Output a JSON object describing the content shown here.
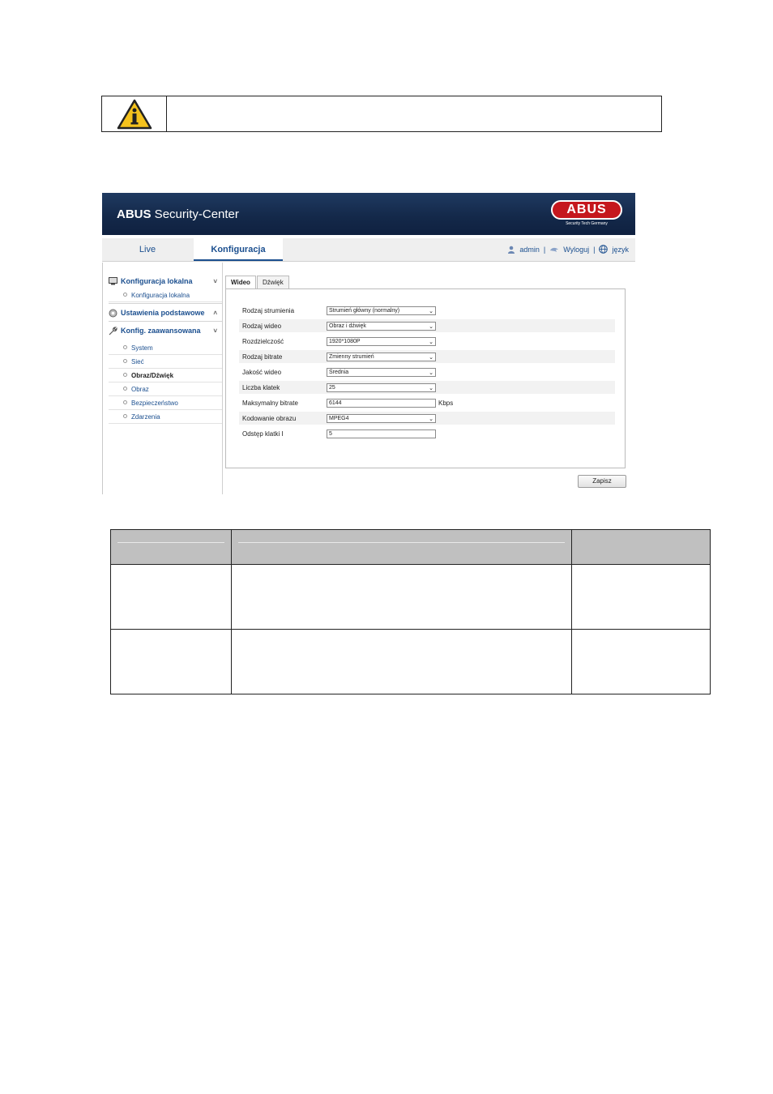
{
  "notice": {
    "icon": "info-warning-icon",
    "text": ""
  },
  "app": {
    "brand": {
      "bold": "ABUS",
      "rest": " Security-Center"
    },
    "logo": {
      "text": "ABUS",
      "tagline": "Security Tech Germany"
    },
    "nav": {
      "live": "Live",
      "konfiguracja": "Konfiguracja"
    },
    "user": {
      "admin": "admin",
      "sep1": "|",
      "logout": "Wyloguj",
      "sep2": "|",
      "language": "język"
    },
    "sidebar": {
      "local": {
        "label": "Konfiguracja lokalna",
        "chevron": "˅",
        "sub": "Konfiguracja lokalna"
      },
      "basic": {
        "label": "Ustawienia podstawowe",
        "chevron": "˄"
      },
      "advanced": {
        "label": "Konfig. zaawansowana",
        "chevron": "˅",
        "items": [
          "System",
          "Sieć",
          "Obraz/Dźwięk",
          "Obraz",
          "Bezpieczeństwo",
          "Zdarzenia"
        ]
      }
    },
    "tabs": {
      "video": "Wideo",
      "audio": "Dźwięk"
    },
    "form": {
      "stream_type": {
        "label": "Rodzaj strumienia",
        "value": "Strumień główny (normalny)"
      },
      "video_type": {
        "label": "Rodzaj wideo",
        "value": "Obraz i dźwięk"
      },
      "resolution": {
        "label": "Rozdzielczość",
        "value": "1920*1080P"
      },
      "bitrate_type": {
        "label": "Rodzaj bitrate",
        "value": "Zmienny strumień"
      },
      "video_quality": {
        "label": "Jakość wideo",
        "value": "Średnia"
      },
      "frame_rate": {
        "label": "Liczba klatek",
        "value": "25"
      },
      "max_bitrate": {
        "label": "Maksymalny bitrate",
        "value": "6144",
        "unit": "Kbps"
      },
      "encoding": {
        "label": "Kodowanie obrazu",
        "value": "MPEG4"
      },
      "i_frame": {
        "label": "Odstęp klatki I",
        "value": "5"
      }
    },
    "save_label": "Zapisz"
  },
  "table": {
    "headers": [
      "",
      "",
      ""
    ],
    "rows": [
      [
        "",
        "",
        ""
      ],
      [
        "",
        "",
        ""
      ]
    ]
  }
}
